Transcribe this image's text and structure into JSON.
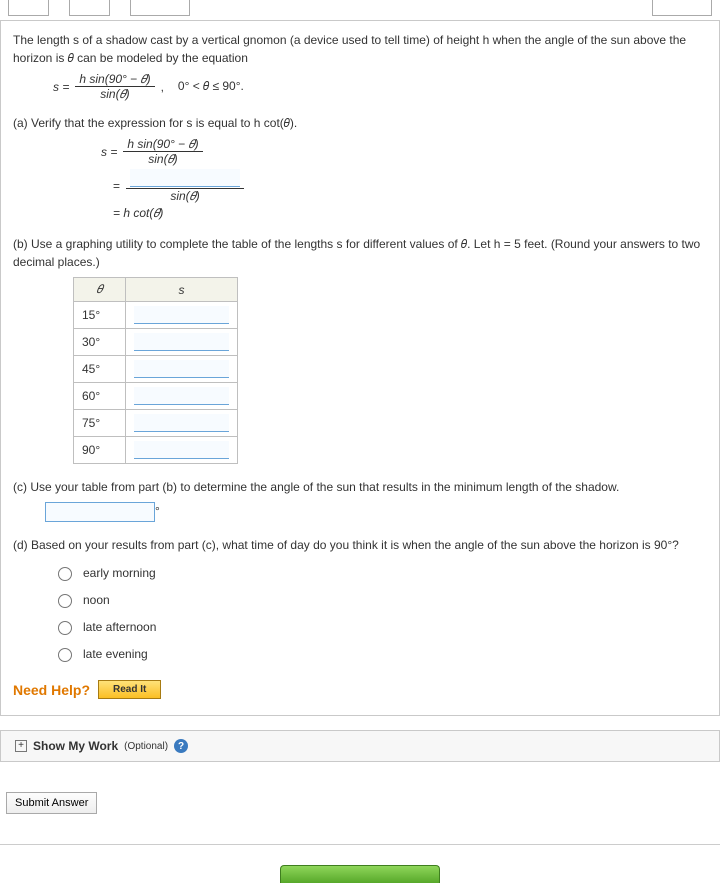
{
  "intro": "The length s of a shadow cast by a vertical gnomon (a device used to tell time) of height h when the angle of the sun above the horizon is 𝜃 can be modeled by the equation",
  "equation": {
    "lhs": "s =",
    "num": "h sin(90° − 𝜃)",
    "den": "sin(𝜃)",
    "comma": ",",
    "domain": "0° < 𝜃 ≤ 90°."
  },
  "partA": {
    "prompt": "(a) Verify that the expression for s is equal to  h cot(𝜃).",
    "row1_lhs": "s =",
    "row1_num": "h sin(90° − 𝜃)",
    "row1_den": "sin(𝜃)",
    "row2_eq": "=",
    "row2_den": "sin(𝜃)",
    "row3": "=  h cot(𝜃)"
  },
  "partB": {
    "prompt": "(b) Use a graphing utility to complete the table of the lengths s for different values of 𝜃. Let h = 5 feet. (Round your answers to two decimal places.)",
    "head_theta": "𝜃",
    "head_s": "s",
    "rows": [
      "15°",
      "30°",
      "45°",
      "60°",
      "75°",
      "90°"
    ]
  },
  "partC": {
    "prompt": "(c) Use your table from part (b) to determine the angle of the sun that results in the minimum length of the shadow.",
    "suffix": "°"
  },
  "partD": {
    "prompt": "(d) Based on your results from part (c), what time of day do you think it is when the angle of the sun above the horizon is 90°?",
    "options": [
      "early morning",
      "noon",
      "late afternoon",
      "late evening"
    ]
  },
  "help": {
    "label": "Need Help?",
    "read": "Read It"
  },
  "showWork": {
    "label": "Show My Work",
    "optional": "(Optional)"
  },
  "submit": "Submit Answer"
}
